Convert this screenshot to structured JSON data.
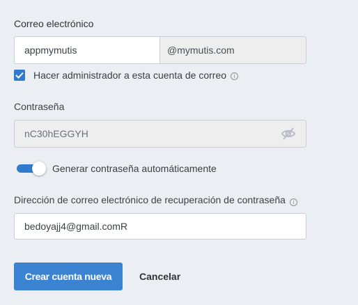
{
  "email": {
    "label": "Correo electrónico",
    "username_value": "appmymutis",
    "domain": "@mymutis.com"
  },
  "admin": {
    "checked": true,
    "label": "Hacer administrador a esta cuenta de correo",
    "info_icon": "i"
  },
  "password": {
    "label": "Contraseña",
    "value": "nC30hEGGYH",
    "visibility_icon": "eye-off-icon"
  },
  "auto_password": {
    "enabled": true,
    "label": "Generar contraseña automáticamente"
  },
  "recovery": {
    "label": "Dirección de correo electrónico de recuperación de contraseña",
    "info_icon": "i",
    "value": "bedoyajj4@gmail.comR"
  },
  "actions": {
    "create_label": "Crear cuenta nueva",
    "cancel_label": "Cancelar"
  },
  "colors": {
    "background": "#ebeef3",
    "accent": "#3b82d0"
  }
}
